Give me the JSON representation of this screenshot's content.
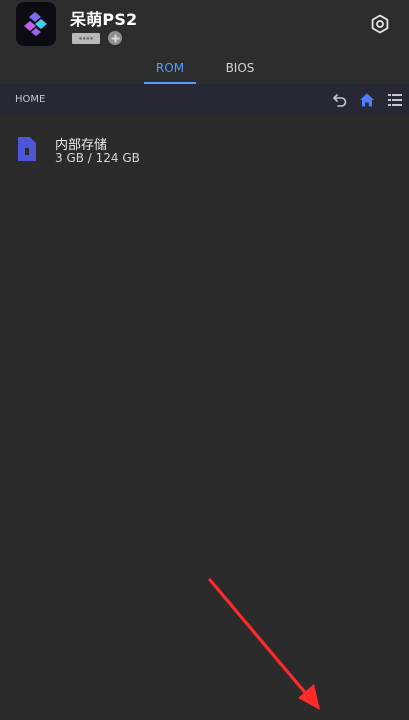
{
  "app": {
    "title": "呆萌PS2"
  },
  "icons": {
    "app_logo": "game-controller-logo",
    "settings": "settings-gear-icon",
    "plus": "plus-badge-icon",
    "back": "undo-arrow-icon",
    "home": "home-icon",
    "list": "list-view-icon",
    "sd_card": "sd-card-icon"
  },
  "tabs": [
    {
      "label": "ROM",
      "active": true
    },
    {
      "label": "BIOS",
      "active": false
    }
  ],
  "pathbar": {
    "label": "HOME"
  },
  "storage": {
    "name": "内部存储",
    "size": "3 GB / 124 GB"
  },
  "colors": {
    "accent": "#4f9dff",
    "header_bg": "#2d2d2d",
    "pathbar_bg": "#272833",
    "content_bg": "#2b2b2b",
    "sd_card": "#4e55d6",
    "annotation_arrow": "#ff2a2a"
  }
}
